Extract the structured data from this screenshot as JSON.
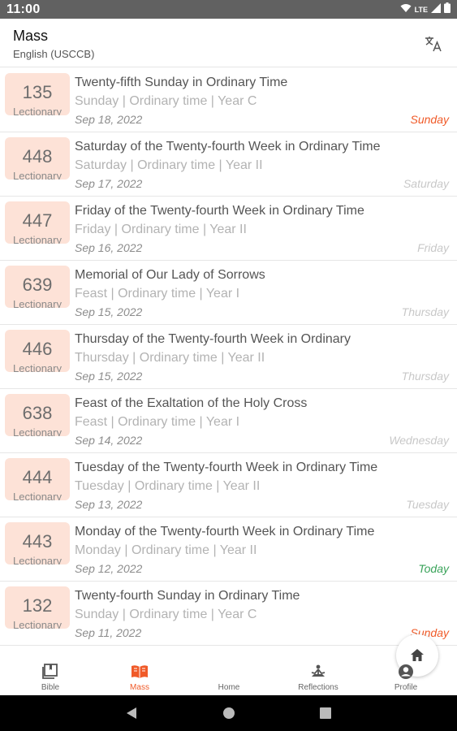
{
  "status": {
    "time": "11:00",
    "network": "LTE"
  },
  "header": {
    "title": "Mass",
    "subtitle": "English (USCCB)"
  },
  "lectionary_label": "Lectionary",
  "colors": {
    "accent": "#f05a28",
    "today": "#3aa35a",
    "weekday": "#c8c8c8",
    "badge": "#fde2d7"
  },
  "entries": [
    {
      "number": "135",
      "title": "Twenty-fifth Sunday in Ordinary Time",
      "meta": "Sunday | Ordinary time | Year C",
      "date": "Sep 18, 2022",
      "day": "Sunday",
      "day_type": "sunday"
    },
    {
      "number": "448",
      "title": "Saturday of the Twenty-fourth Week in Ordinary Time",
      "meta": "Saturday | Ordinary time | Year II",
      "date": "Sep 17, 2022",
      "day": "Saturday",
      "day_type": "weekday"
    },
    {
      "number": "447",
      "title": "Friday of the Twenty-fourth Week in Ordinary Time",
      "meta": "Friday | Ordinary time | Year II",
      "date": "Sep 16, 2022",
      "day": "Friday",
      "day_type": "weekday"
    },
    {
      "number": "639",
      "title": "Memorial of Our Lady of Sorrows",
      "meta": "Feast | Ordinary time | Year I",
      "date": "Sep 15, 2022",
      "day": "Thursday",
      "day_type": "weekday"
    },
    {
      "number": "446",
      "title": "Thursday of the Twenty-fourth Week in Ordinary",
      "meta": "Thursday | Ordinary time | Year II",
      "date": "Sep 15, 2022",
      "day": "Thursday",
      "day_type": "weekday"
    },
    {
      "number": "638",
      "title": "Feast of the Exaltation of the Holy Cross",
      "meta": "Feast | Ordinary time | Year I",
      "date": "Sep 14, 2022",
      "day": "Wednesday",
      "day_type": "weekday"
    },
    {
      "number": "444",
      "title": "Tuesday of the Twenty-fourth Week in Ordinary Time",
      "meta": "Tuesday | Ordinary time | Year II",
      "date": "Sep 13, 2022",
      "day": "Tuesday",
      "day_type": "weekday"
    },
    {
      "number": "443",
      "title": "Monday of the Twenty-fourth Week in Ordinary Time",
      "meta": "Monday | Ordinary time | Year II",
      "date": "Sep 12, 2022",
      "day": "Today",
      "day_type": "today"
    },
    {
      "number": "132",
      "title": "Twenty-fourth Sunday in Ordinary Time",
      "meta": "Sunday | Ordinary time | Year C",
      "date": "Sep 11, 2022",
      "day": "Sunday",
      "day_type": "sunday"
    }
  ],
  "nav": {
    "bible": "Bible",
    "mass": "Mass",
    "home": "Home",
    "reflections": "Reflections",
    "profile": "Profile",
    "active": "mass"
  }
}
